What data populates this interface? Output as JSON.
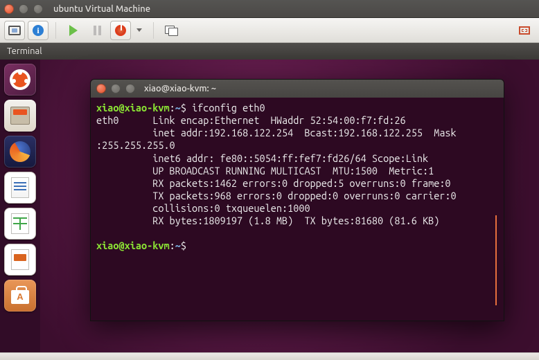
{
  "host": {
    "title": "ubuntu Virtual Machine",
    "toolbar": {
      "screen": "console-icon",
      "info": "info-icon",
      "play": "start-vm-button",
      "pause": "pause-vm-button",
      "power": "poweroff-vm-button",
      "switch": "switch-view-button",
      "full": "fullscreen-button"
    }
  },
  "vm": {
    "menubar_app": "Terminal"
  },
  "terminal": {
    "title": "xiao@xiao-kvm: ~",
    "prompt_user": "xiao@xiao-kvm",
    "prompt_colon": ":",
    "prompt_path": "~",
    "prompt_dollar": "$",
    "cmd1": " ifconfig eth0",
    "out": "eth0      Link encap:Ethernet  HWaddr 52:54:00:f7:fd:26\n          inet addr:192.168.122.254  Bcast:192.168.122.255  Mask\n:255.255.255.0\n          inet6 addr: fe80::5054:ff:fef7:fd26/64 Scope:Link\n          UP BROADCAST RUNNING MULTICAST  MTU:1500  Metric:1\n          RX packets:1462 errors:0 dropped:5 overruns:0 frame:0\n          TX packets:968 errors:0 dropped:0 overruns:0 carrier:0\n          collisions:0 txqueuelen:1000\n          RX bytes:1809197 (1.8 MB)  TX bytes:81680 (81.6 KB)\n"
  }
}
